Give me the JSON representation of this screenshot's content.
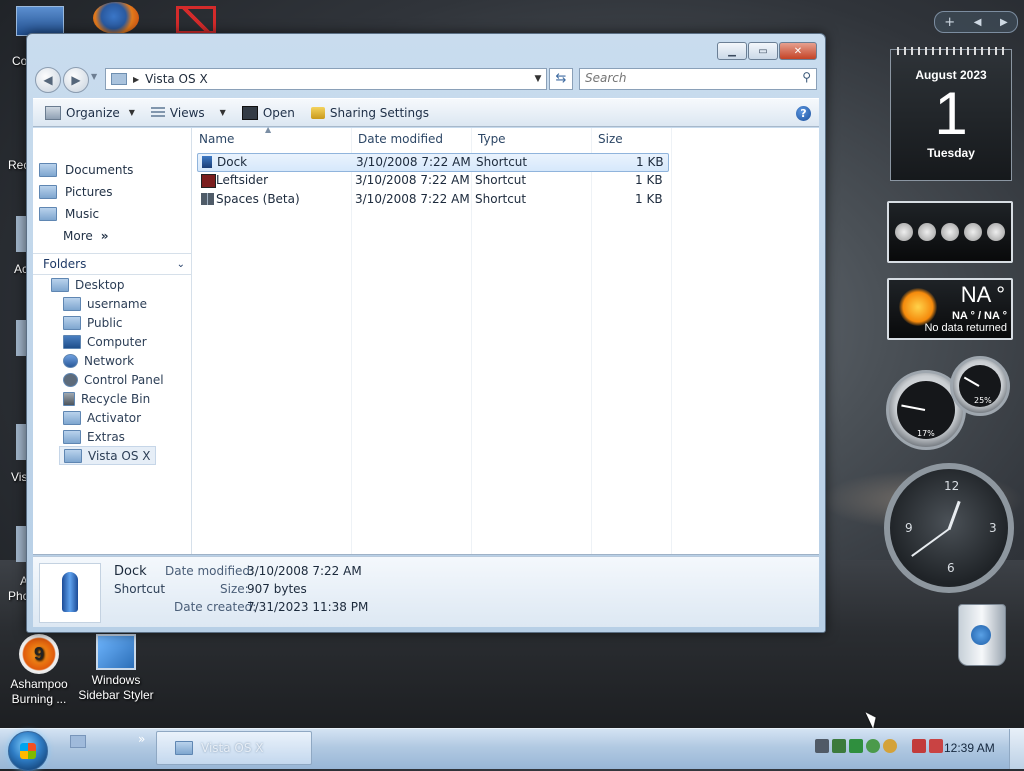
{
  "desktop": {
    "icons": [
      {
        "label": "Ashampoo Burning ..."
      },
      {
        "label": "Windows Sidebar Styler"
      }
    ],
    "edge_labels": [
      "Co",
      "Rec",
      "Ac",
      "Vis",
      "A",
      "Phc"
    ]
  },
  "window": {
    "address_path": "Vista OS X",
    "search_placeholder": "Search",
    "toolbar": {
      "organize": "Organize",
      "views": "Views",
      "open": "Open",
      "sharing": "Sharing Settings"
    },
    "favorites": [
      {
        "label": "Documents"
      },
      {
        "label": "Pictures"
      },
      {
        "label": "Music"
      },
      {
        "label": "More"
      }
    ],
    "folders_label": "Folders",
    "tree": [
      {
        "label": "Desktop"
      },
      {
        "label": "username"
      },
      {
        "label": "Public"
      },
      {
        "label": "Computer"
      },
      {
        "label": "Network"
      },
      {
        "label": "Control Panel"
      },
      {
        "label": "Recycle Bin"
      },
      {
        "label": "Activator"
      },
      {
        "label": "Extras"
      },
      {
        "label": "Vista OS X"
      }
    ],
    "columns": {
      "name": "Name",
      "date": "Date modified",
      "type": "Type",
      "size": "Size"
    },
    "files": [
      {
        "name": "Dock",
        "date": "3/10/2008 7:22 AM",
        "type": "Shortcut",
        "size": "1 KB"
      },
      {
        "name": "Leftsider",
        "date": "3/10/2008 7:22 AM",
        "type": "Shortcut",
        "size": "1 KB"
      },
      {
        "name": "Spaces (Beta)",
        "date": "3/10/2008 7:22 AM",
        "type": "Shortcut",
        "size": "1 KB"
      }
    ],
    "details": {
      "name": "Dock",
      "kind": "Shortcut",
      "modified_label": "Date modified:",
      "modified_value": "3/10/2008 7:22 AM",
      "size_label": "Size:",
      "size_value": "907 bytes",
      "created_label": "Date created:",
      "created_value": "7/31/2023 11:38 PM"
    }
  },
  "sidebar": {
    "calendar": {
      "month": "August 2023",
      "day": "1",
      "weekday": "Tuesday"
    },
    "weather": {
      "temp": "NA °",
      "range": "NA ° / NA °",
      "status": "No data returned"
    },
    "cpu_gauge": {
      "label": "17%",
      "percent": 17
    },
    "mem_gauge": {
      "label": "25%",
      "percent": 25
    },
    "clock_numbers": [
      "12",
      "3",
      "6",
      "9"
    ]
  },
  "taskbar": {
    "task_label": "Vista OS X",
    "time": "12:39 AM"
  }
}
